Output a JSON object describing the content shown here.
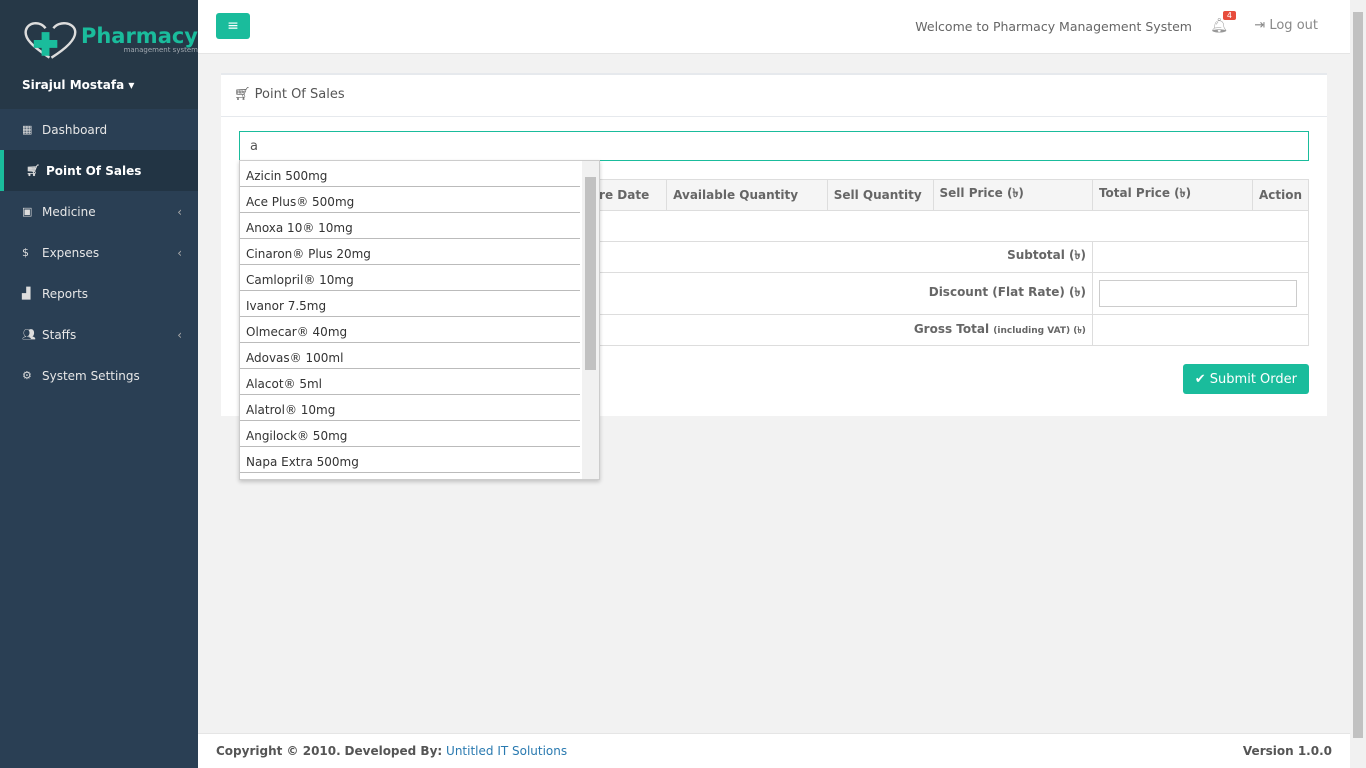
{
  "brand": {
    "name": "Pharmacy",
    "tagline": "management system"
  },
  "user": "Sirajul Mostafa",
  "nav": [
    {
      "label": "Dashboard",
      "icon": "grid-icon"
    },
    {
      "label": "Point Of Sales",
      "icon": "cart-icon",
      "active": true
    },
    {
      "label": "Medicine",
      "icon": "medkit-icon",
      "chevron": true
    },
    {
      "label": "Expenses",
      "icon": "dollar-icon",
      "chevron": true
    },
    {
      "label": "Reports",
      "icon": "chart-icon"
    },
    {
      "label": "Staffs",
      "icon": "users-icon",
      "chevron": true
    },
    {
      "label": "System Settings",
      "icon": "gears-icon"
    }
  ],
  "topbar": {
    "welcome": "Welcome to Pharmacy Management System",
    "notifications": "4",
    "logout": "Log out"
  },
  "panel": {
    "title": "Point Of Sales",
    "search_value": "a",
    "headers": [
      "Expire Date",
      "Available Quantity",
      "Sell Quantity",
      "Sell Price (৳)",
      "Total Price (৳)",
      "Action"
    ],
    "subtotal": "Subtotal (৳)",
    "discount": "Discount (Flat Rate) (৳)",
    "gross": "Gross Total",
    "gross_note": "(including VAT) (৳)",
    "submit": "Submit Order"
  },
  "suggestions": [
    "Azicin 500mg",
    "Ace Plus® 500mg",
    "Anoxa 10® 10mg",
    "Cinaron® Plus 20mg",
    "Camlopril® 10mg",
    "Ivanor 7.5mg",
    "Olmecar® 40mg",
    "Adovas® 100ml",
    "Alacot® 5ml",
    "Alatrol® 10mg",
    "Angilock® 50mg",
    "Napa Extra 500mg"
  ],
  "footer": {
    "copyright": "Copyright © 2010.",
    "dev_label": "Developed By:",
    "dev": "Untitled IT Solutions",
    "version": "Version 1.0.0"
  },
  "colors": {
    "accent": "#1abc9c",
    "sidebar": "#2a3f54"
  }
}
